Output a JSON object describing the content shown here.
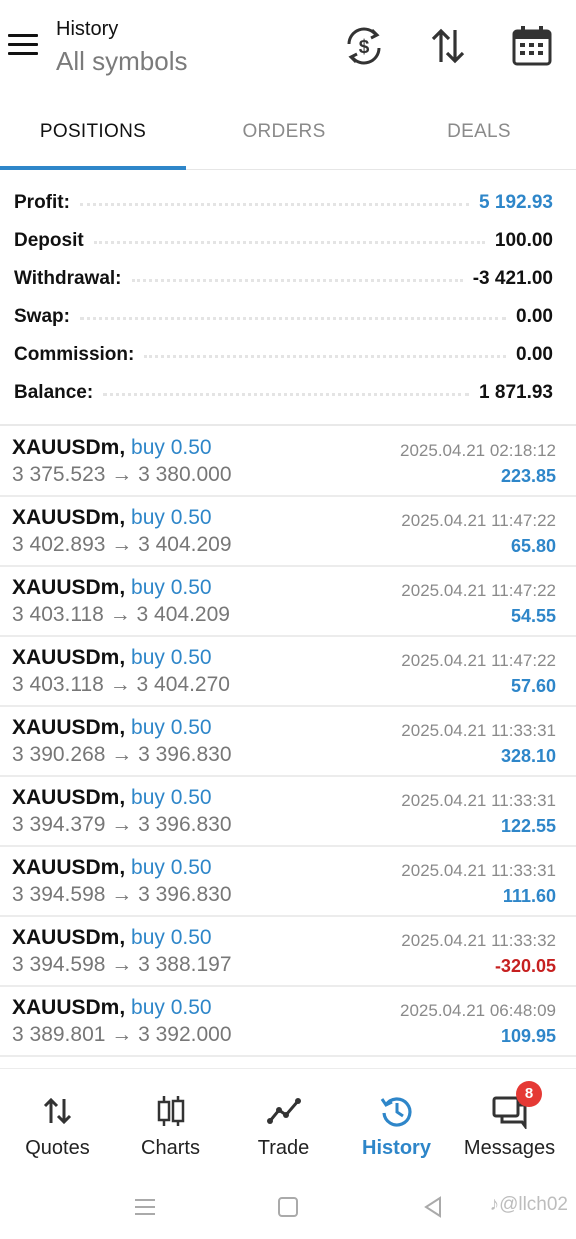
{
  "header": {
    "title_small": "History",
    "title_large": "All symbols",
    "icons": [
      "menu-icon",
      "currency-exchange-icon",
      "sort-icon",
      "calendar-icon"
    ]
  },
  "tabs": [
    {
      "label": "POSITIONS",
      "active": true
    },
    {
      "label": "ORDERS",
      "active": false
    },
    {
      "label": "DEALS",
      "active": false
    }
  ],
  "summary": {
    "profit": {
      "label": "Profit:",
      "value": "5 192.93"
    },
    "deposit": {
      "label": "Deposit",
      "value": "100.00"
    },
    "withdrawal": {
      "label": "Withdrawal:",
      "value": "-3 421.00"
    },
    "swap": {
      "label": "Swap:",
      "value": "0.00"
    },
    "commission": {
      "label": "Commission:",
      "value": "0.00"
    },
    "balance": {
      "label": "Balance:",
      "value": "1 871.93"
    }
  },
  "trades": [
    {
      "symbol": "XAUUSDm,",
      "side": "buy 0.50",
      "prices": "3 375.523 → 3 380.000",
      "date": "2025.04.21 02:18:12",
      "pnl": "223.85",
      "negative": false
    },
    {
      "symbol": "XAUUSDm,",
      "side": "buy 0.50",
      "prices": "3 402.893 → 3 404.209",
      "date": "2025.04.21 11:47:22",
      "pnl": "65.80",
      "negative": false
    },
    {
      "symbol": "XAUUSDm,",
      "side": "buy 0.50",
      "prices": "3 403.118 → 3 404.209",
      "date": "2025.04.21 11:47:22",
      "pnl": "54.55",
      "negative": false
    },
    {
      "symbol": "XAUUSDm,",
      "side": "buy 0.50",
      "prices": "3 403.118 → 3 404.270",
      "date": "2025.04.21 11:47:22",
      "pnl": "57.60",
      "negative": false
    },
    {
      "symbol": "XAUUSDm,",
      "side": "buy 0.50",
      "prices": "3 390.268 → 3 396.830",
      "date": "2025.04.21 11:33:31",
      "pnl": "328.10",
      "negative": false
    },
    {
      "symbol": "XAUUSDm,",
      "side": "buy 0.50",
      "prices": "3 394.379 → 3 396.830",
      "date": "2025.04.21 11:33:31",
      "pnl": "122.55",
      "negative": false
    },
    {
      "symbol": "XAUUSDm,",
      "side": "buy 0.50",
      "prices": "3 394.598 → 3 396.830",
      "date": "2025.04.21 11:33:31",
      "pnl": "111.60",
      "negative": false
    },
    {
      "symbol": "XAUUSDm,",
      "side": "buy 0.50",
      "prices": "3 394.598 → 3 388.197",
      "date": "2025.04.21 11:33:32",
      "pnl": "-320.05",
      "negative": true
    },
    {
      "symbol": "XAUUSDm,",
      "side": "buy 0.50",
      "prices": "3 389.801 → 3 392.000",
      "date": "2025.04.21 06:48:09",
      "pnl": "109.95",
      "negative": false
    }
  ],
  "bottom_nav": [
    {
      "label": "Quotes",
      "icon": "quotes-arrows-icon",
      "active": false
    },
    {
      "label": "Charts",
      "icon": "candlestick-icon",
      "active": false
    },
    {
      "label": "Trade",
      "icon": "trade-line-icon",
      "active": false
    },
    {
      "label": "History",
      "icon": "history-clock-icon",
      "active": true
    },
    {
      "label": "Messages",
      "icon": "messages-icon",
      "active": false,
      "badge": "8"
    }
  ],
  "system_bar": {
    "watermark": "♪@llch02"
  },
  "colors": {
    "accent": "#2e86c9",
    "negative": "#c62020",
    "badge": "#e53935"
  }
}
